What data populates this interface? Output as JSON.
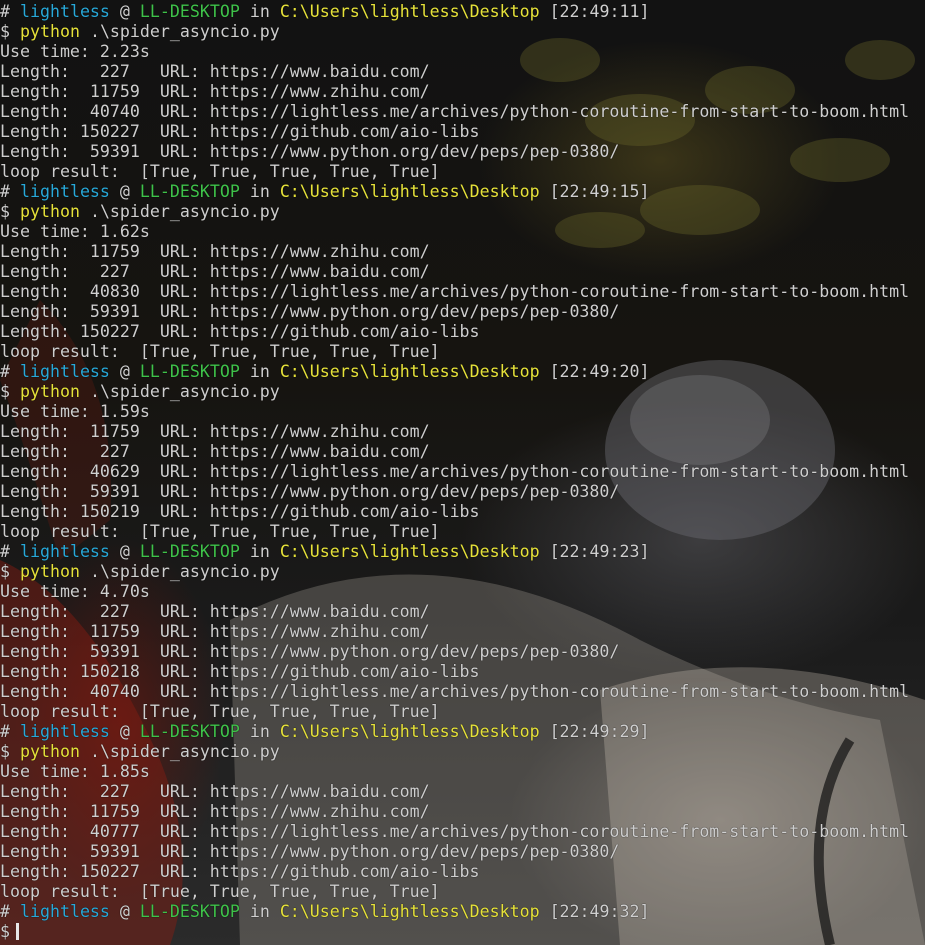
{
  "terminal": {
    "colors": {
      "user": "#28a8d8",
      "host": "#3fc24a",
      "path": "#e6e23a",
      "command": "#e6e23a",
      "text": "#cfcfcf"
    },
    "blocks": [
      {
        "prompt": {
          "hash": "#",
          "user": "lightless",
          "at": "@",
          "host": "LL-DESKTOP",
          "in": "in",
          "path": "C:\\Users\\lightless\\Desktop",
          "time": "[22:49:11]"
        },
        "command": {
          "dollar": "$",
          "cmd": "python",
          "args": ".\\spider_asyncio.py"
        },
        "use_time": "Use time: 2.23s",
        "results": [
          "Length:   227   URL: https://www.baidu.com/",
          "Length:  11759  URL: https://www.zhihu.com/",
          "Length:  40740  URL: https://lightless.me/archives/python-coroutine-from-start-to-boom.html",
          "Length: 150227  URL: https://github.com/aio-libs",
          "Length:  59391  URL: https://www.python.org/dev/peps/pep-0380/"
        ],
        "loop_result": "loop result:  [True, True, True, True, True]"
      },
      {
        "prompt": {
          "hash": "#",
          "user": "lightless",
          "at": "@",
          "host": "LL-DESKTOP",
          "in": "in",
          "path": "C:\\Users\\lightless\\Desktop",
          "time": "[22:49:15]"
        },
        "command": {
          "dollar": "$",
          "cmd": "python",
          "args": ".\\spider_asyncio.py"
        },
        "use_time": "Use time: 1.62s",
        "results": [
          "Length:  11759  URL: https://www.zhihu.com/",
          "Length:   227   URL: https://www.baidu.com/",
          "Length:  40830  URL: https://lightless.me/archives/python-coroutine-from-start-to-boom.html",
          "Length:  59391  URL: https://www.python.org/dev/peps/pep-0380/",
          "Length: 150227  URL: https://github.com/aio-libs"
        ],
        "loop_result": "loop result:  [True, True, True, True, True]"
      },
      {
        "prompt": {
          "hash": "#",
          "user": "lightless",
          "at": "@",
          "host": "LL-DESKTOP",
          "in": "in",
          "path": "C:\\Users\\lightless\\Desktop",
          "time": "[22:49:20]"
        },
        "command": {
          "dollar": "$",
          "cmd": "python",
          "args": ".\\spider_asyncio.py"
        },
        "use_time": "Use time: 1.59s",
        "results": [
          "Length:  11759  URL: https://www.zhihu.com/",
          "Length:   227   URL: https://www.baidu.com/",
          "Length:  40629  URL: https://lightless.me/archives/python-coroutine-from-start-to-boom.html",
          "Length:  59391  URL: https://www.python.org/dev/peps/pep-0380/",
          "Length: 150219  URL: https://github.com/aio-libs"
        ],
        "loop_result": "loop result:  [True, True, True, True, True]"
      },
      {
        "prompt": {
          "hash": "#",
          "user": "lightless",
          "at": "@",
          "host": "LL-DESKTOP",
          "in": "in",
          "path": "C:\\Users\\lightless\\Desktop",
          "time": "[22:49:23]"
        },
        "command": {
          "dollar": "$",
          "cmd": "python",
          "args": ".\\spider_asyncio.py"
        },
        "use_time": "Use time: 4.70s",
        "results": [
          "Length:   227   URL: https://www.baidu.com/",
          "Length:  11759  URL: https://www.zhihu.com/",
          "Length:  59391  URL: https://www.python.org/dev/peps/pep-0380/",
          "Length: 150218  URL: https://github.com/aio-libs",
          "Length:  40740  URL: https://lightless.me/archives/python-coroutine-from-start-to-boom.html"
        ],
        "loop_result": "loop result:  [True, True, True, True, True]"
      },
      {
        "prompt": {
          "hash": "#",
          "user": "lightless",
          "at": "@",
          "host": "LL-DESKTOP",
          "in": "in",
          "path": "C:\\Users\\lightless\\Desktop",
          "time": "[22:49:29]"
        },
        "command": {
          "dollar": "$",
          "cmd": "python",
          "args": ".\\spider_asyncio.py"
        },
        "use_time": "Use time: 1.85s",
        "results": [
          "Length:   227   URL: https://www.baidu.com/",
          "Length:  11759  URL: https://www.zhihu.com/",
          "Length:  40777  URL: https://lightless.me/archives/python-coroutine-from-start-to-boom.html",
          "Length:  59391  URL: https://www.python.org/dev/peps/pep-0380/",
          "Length: 150227  URL: https://github.com/aio-libs"
        ],
        "loop_result": "loop result:  [True, True, True, True, True]"
      }
    ],
    "final_prompt": {
      "hash": "#",
      "user": "lightless",
      "at": "@",
      "host": "LL-DESKTOP",
      "in": "in",
      "path": "C:\\Users\\lightless\\Desktop",
      "time": "[22:49:32]"
    },
    "input_line": {
      "dollar": "$",
      "value": ""
    }
  }
}
